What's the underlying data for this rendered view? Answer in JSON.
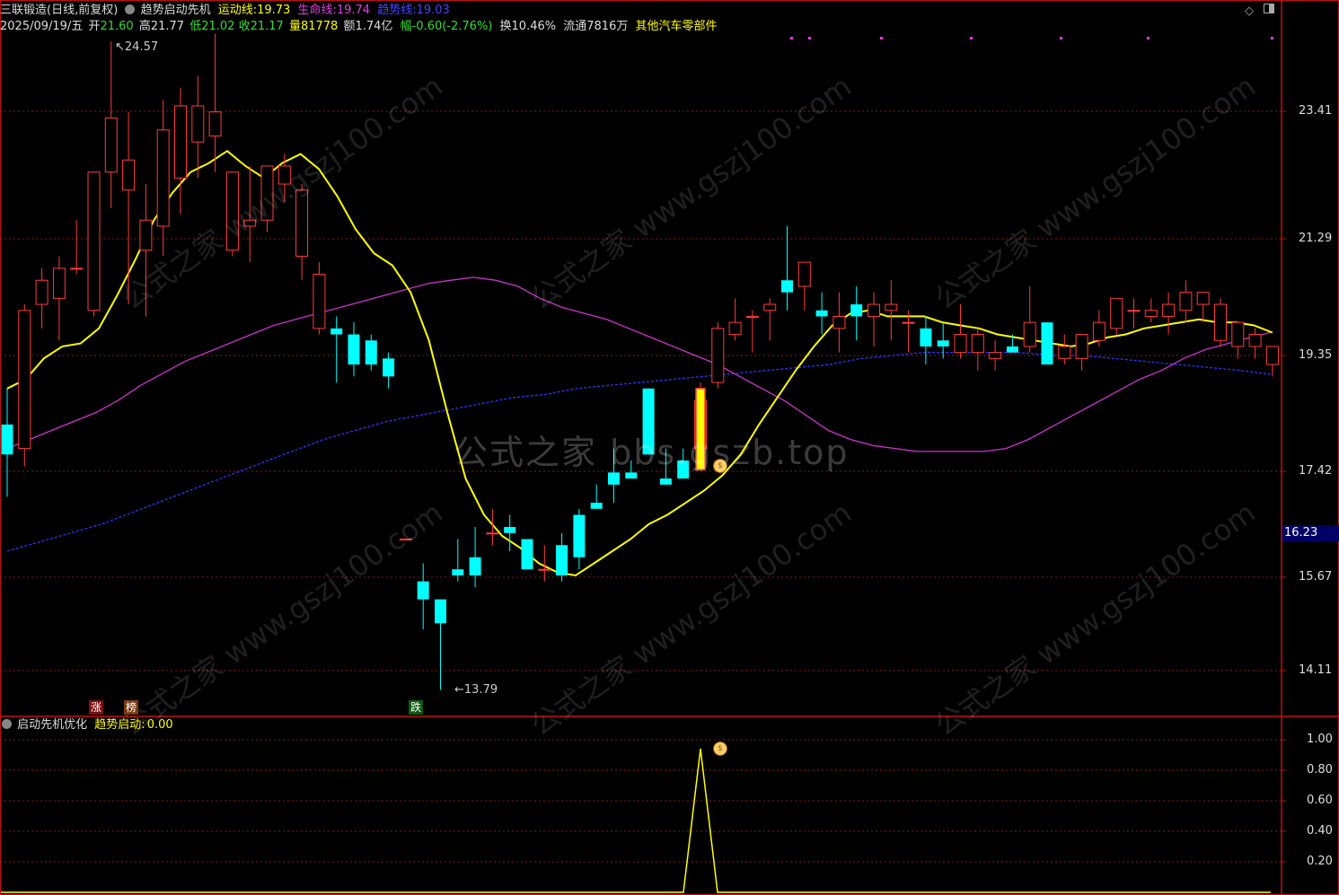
{
  "header": {
    "stock_name": "三联锻造(日线,前复权)",
    "indicator_name": "趋势启动先机",
    "motion_line_label": "运动线:",
    "motion_line_value": "19.73",
    "life_line_label": "生命线:",
    "life_line_value": "19.74",
    "trend_line_label": "趋势线:",
    "trend_line_value": "19.03",
    "date": "2025/09/19/五",
    "open_label": "开",
    "open": "21.60",
    "high_label": "高",
    "high": "21.77",
    "low_label": "低",
    "low": "21.02",
    "close_label": "收",
    "close": "21.17",
    "volume_label": "量",
    "volume": "81778",
    "amount_label": "额",
    "amount": "1.74亿",
    "change_label": "幅",
    "change": "-0.60(-2.76%)",
    "turnover_label": "换",
    "turnover": "10.46%",
    "float_label": "流通",
    "float": "7816万",
    "sector": "其他汽车零部件"
  },
  "price_axis": [
    "23.41",
    "21.29",
    "19.35",
    "17.42",
    "15.67",
    "14.11"
  ],
  "current_price_tag": "16.23",
  "annotations": {
    "high_mark": "24.57",
    "low_mark": "13.79"
  },
  "tags": {
    "up": "涨",
    "list": "榜",
    "down": "跌"
  },
  "sub_panel": {
    "name": "启动先机优化",
    "signal_label": "趋势启动:",
    "signal_value": "0.00",
    "axis": [
      "1.00",
      "0.80",
      "0.60",
      "0.40",
      "0.20"
    ]
  },
  "watermarks": {
    "center": "公式之家 bbs.gszb.top",
    "tile": "公式之家 www.gszj100.com"
  },
  "colors": {
    "up": "#ff3b3b",
    "down": "#00ffff",
    "motion_line": "#ffff00",
    "life_line": "#cc33cc",
    "trend_line": "#3333ff",
    "grid": "#8a1a1a",
    "axis_text": "#dddddd",
    "signal": "#ffff00"
  },
  "toolbar_icons": [
    "diamond-icon",
    "window-icon"
  ],
  "chart_data": {
    "type": "candlestick",
    "y_axis_ticks": [
      23.41,
      21.29,
      19.35,
      17.42,
      15.67,
      14.11
    ],
    "candles": [
      {
        "o": 18.2,
        "h": 18.8,
        "l": 17.0,
        "c": 17.7
      },
      {
        "o": 17.8,
        "h": 20.2,
        "l": 17.5,
        "c": 20.1
      },
      {
        "o": 20.2,
        "h": 20.8,
        "l": 19.8,
        "c": 20.6
      },
      {
        "o": 20.3,
        "h": 21.0,
        "l": 19.6,
        "c": 20.8
      },
      {
        "o": 20.8,
        "h": 21.6,
        "l": 20.7,
        "c": 20.8
      },
      {
        "o": 20.1,
        "h": 22.4,
        "l": 20.0,
        "c": 22.4
      },
      {
        "o": 22.4,
        "h": 24.57,
        "l": 21.8,
        "c": 23.3
      },
      {
        "o": 22.1,
        "h": 23.4,
        "l": 20.2,
        "c": 22.6
      },
      {
        "o": 21.1,
        "h": 22.2,
        "l": 20.0,
        "c": 21.6
      },
      {
        "o": 21.5,
        "h": 23.6,
        "l": 21.0,
        "c": 23.1
      },
      {
        "o": 22.3,
        "h": 23.8,
        "l": 21.7,
        "c": 23.5
      },
      {
        "o": 22.9,
        "h": 24.0,
        "l": 22.3,
        "c": 23.5
      },
      {
        "o": 23.0,
        "h": 24.7,
        "l": 22.4,
        "c": 23.4
      },
      {
        "o": 21.1,
        "h": 22.4,
        "l": 21.0,
        "c": 22.4
      },
      {
        "o": 21.5,
        "h": 22.5,
        "l": 20.9,
        "c": 21.6
      },
      {
        "o": 21.6,
        "h": 22.5,
        "l": 21.4,
        "c": 22.5
      },
      {
        "o": 22.2,
        "h": 22.7,
        "l": 21.9,
        "c": 22.5
      },
      {
        "o": 21.0,
        "h": 22.2,
        "l": 20.6,
        "c": 22.1
      },
      {
        "o": 19.8,
        "h": 20.9,
        "l": 19.7,
        "c": 20.7
      },
      {
        "o": 19.8,
        "h": 20.0,
        "l": 18.9,
        "c": 19.7
      },
      {
        "o": 19.7,
        "h": 19.9,
        "l": 19.0,
        "c": 19.2
      },
      {
        "o": 19.6,
        "h": 19.7,
        "l": 19.1,
        "c": 19.2
      },
      {
        "o": 19.3,
        "h": 19.4,
        "l": 18.8,
        "c": 19.0
      },
      {
        "o": 16.3,
        "h": 16.3,
        "l": 16.3,
        "c": 16.3
      },
      {
        "o": 15.6,
        "h": 15.9,
        "l": 14.8,
        "c": 15.3
      },
      {
        "o": 15.3,
        "h": 15.3,
        "l": 13.79,
        "c": 14.9
      },
      {
        "o": 15.8,
        "h": 16.3,
        "l": 15.6,
        "c": 15.7
      },
      {
        "o": 16.0,
        "h": 16.5,
        "l": 15.5,
        "c": 15.7
      },
      {
        "o": 16.4,
        "h": 16.8,
        "l": 16.2,
        "c": 16.4
      },
      {
        "o": 16.5,
        "h": 16.7,
        "l": 16.1,
        "c": 16.4
      },
      {
        "o": 16.3,
        "h": 16.3,
        "l": 15.8,
        "c": 15.8
      },
      {
        "o": 15.8,
        "h": 16.2,
        "l": 15.6,
        "c": 15.8
      },
      {
        "o": 16.2,
        "h": 16.4,
        "l": 15.6,
        "c": 15.7
      },
      {
        "o": 16.7,
        "h": 16.8,
        "l": 15.8,
        "c": 16.0
      },
      {
        "o": 16.9,
        "h": 17.2,
        "l": 16.8,
        "c": 16.8
      },
      {
        "o": 17.4,
        "h": 17.8,
        "l": 16.9,
        "c": 17.2
      },
      {
        "o": 17.4,
        "h": 17.6,
        "l": 17.3,
        "c": 17.3
      },
      {
        "o": 18.8,
        "h": 18.8,
        "l": 17.7,
        "c": 17.7
      },
      {
        "o": 17.3,
        "h": 17.8,
        "l": 17.2,
        "c": 17.2
      },
      {
        "o": 17.6,
        "h": 17.8,
        "l": 17.3,
        "c": 17.3
      },
      {
        "o": 17.8,
        "h": 18.9,
        "l": 17.6,
        "c": 18.6
      },
      {
        "o": 18.9,
        "h": 19.9,
        "l": 18.8,
        "c": 19.8
      },
      {
        "o": 19.7,
        "h": 20.3,
        "l": 19.6,
        "c": 19.9
      },
      {
        "o": 20.0,
        "h": 20.1,
        "l": 19.4,
        "c": 20.0
      },
      {
        "o": 20.1,
        "h": 20.3,
        "l": 19.6,
        "c": 20.2
      },
      {
        "o": 20.6,
        "h": 21.5,
        "l": 20.1,
        "c": 20.4
      },
      {
        "o": 20.5,
        "h": 20.9,
        "l": 20.1,
        "c": 20.9
      },
      {
        "o": 20.1,
        "h": 20.4,
        "l": 19.7,
        "c": 20.0
      },
      {
        "o": 19.8,
        "h": 20.4,
        "l": 19.4,
        "c": 20.0
      },
      {
        "o": 20.2,
        "h": 20.5,
        "l": 19.6,
        "c": 20.0
      },
      {
        "o": 20.0,
        "h": 20.4,
        "l": 19.5,
        "c": 20.2
      },
      {
        "o": 20.1,
        "h": 20.6,
        "l": 19.6,
        "c": 20.2
      },
      {
        "o": 19.9,
        "h": 20.1,
        "l": 19.4,
        "c": 19.9
      },
      {
        "o": 19.8,
        "h": 20.0,
        "l": 19.2,
        "c": 19.5
      },
      {
        "o": 19.6,
        "h": 19.9,
        "l": 19.3,
        "c": 19.5
      },
      {
        "o": 19.4,
        "h": 20.2,
        "l": 19.3,
        "c": 19.7
      },
      {
        "o": 19.4,
        "h": 19.8,
        "l": 19.1,
        "c": 19.7
      },
      {
        "o": 19.3,
        "h": 19.6,
        "l": 19.1,
        "c": 19.4
      },
      {
        "o": 19.5,
        "h": 19.7,
        "l": 19.4,
        "c": 19.4
      },
      {
        "o": 19.5,
        "h": 20.5,
        "l": 19.4,
        "c": 19.9
      },
      {
        "o": 19.9,
        "h": 19.9,
        "l": 19.2,
        "c": 19.2
      },
      {
        "o": 19.3,
        "h": 19.7,
        "l": 19.2,
        "c": 19.5
      },
      {
        "o": 19.3,
        "h": 19.6,
        "l": 19.1,
        "c": 19.7
      },
      {
        "o": 19.6,
        "h": 20.1,
        "l": 19.5,
        "c": 19.9
      },
      {
        "o": 19.8,
        "h": 20.3,
        "l": 19.7,
        "c": 20.3
      },
      {
        "o": 20.1,
        "h": 20.3,
        "l": 19.8,
        "c": 20.1
      },
      {
        "o": 20.0,
        "h": 20.3,
        "l": 19.9,
        "c": 20.1
      },
      {
        "o": 20.0,
        "h": 20.4,
        "l": 19.7,
        "c": 20.2
      },
      {
        "o": 20.1,
        "h": 20.6,
        "l": 19.9,
        "c": 20.4
      },
      {
        "o": 20.2,
        "h": 20.4,
        "l": 19.9,
        "c": 20.4
      },
      {
        "o": 19.6,
        "h": 20.3,
        "l": 19.5,
        "c": 20.2
      },
      {
        "o": 19.5,
        "h": 19.9,
        "l": 19.3,
        "c": 19.9
      },
      {
        "o": 19.5,
        "h": 19.8,
        "l": 19.3,
        "c": 19.7
      },
      {
        "o": 19.2,
        "h": 19.5,
        "l": 19.0,
        "c": 19.5
      }
    ],
    "motion_line": [
      18.8,
      18.95,
      19.3,
      19.5,
      19.55,
      19.8,
      20.35,
      20.95,
      21.6,
      22.05,
      22.4,
      22.55,
      22.75,
      22.5,
      22.3,
      22.55,
      22.7,
      22.45,
      22.0,
      21.45,
      21.05,
      20.85,
      20.4,
      19.6,
      18.4,
      17.3,
      16.7,
      16.35,
      16.15,
      15.9,
      15.75,
      15.7,
      15.9,
      16.1,
      16.3,
      16.55,
      16.7,
      16.9,
      17.1,
      17.35,
      17.7,
      18.2,
      18.65,
      19.1,
      19.5,
      19.85,
      20.05,
      20.1,
      20.0,
      20.0,
      20.0,
      19.9,
      19.85,
      19.8,
      19.7,
      19.65,
      19.6,
      19.55,
      19.5,
      19.55,
      19.65,
      19.7,
      19.8,
      19.85,
      19.9,
      19.95,
      19.9,
      19.9,
      19.85,
      19.73
    ],
    "life_line": [
      17.8,
      17.95,
      18.1,
      18.25,
      18.4,
      18.6,
      18.85,
      19.05,
      19.25,
      19.4,
      19.55,
      19.7,
      19.85,
      19.95,
      20.05,
      20.15,
      20.25,
      20.35,
      20.45,
      20.55,
      20.6,
      20.65,
      20.6,
      20.5,
      20.3,
      20.15,
      20.05,
      19.95,
      19.8,
      19.65,
      19.5,
      19.35,
      19.2,
      19.0,
      18.8,
      18.6,
      18.35,
      18.1,
      17.95,
      17.85,
      17.8,
      17.75,
      17.75,
      17.75,
      17.75,
      17.8,
      17.95,
      18.15,
      18.35,
      18.55,
      18.75,
      18.95,
      19.1,
      19.3,
      19.45,
      19.55,
      19.65,
      19.74
    ],
    "trend_line": [
      16.1,
      16.25,
      16.4,
      16.55,
      16.75,
      16.95,
      17.15,
      17.35,
      17.55,
      17.75,
      17.95,
      18.1,
      18.25,
      18.35,
      18.45,
      18.55,
      18.65,
      18.7,
      18.8,
      18.85,
      18.9,
      18.95,
      19.0,
      19.05,
      19.1,
      19.15,
      19.2,
      19.3,
      19.35,
      19.4,
      19.4,
      19.4,
      19.4,
      19.35,
      19.35,
      19.3,
      19.25,
      19.2,
      19.15,
      19.1,
      19.03
    ],
    "signal": {
      "x_index": 40,
      "value": 1.0
    }
  }
}
